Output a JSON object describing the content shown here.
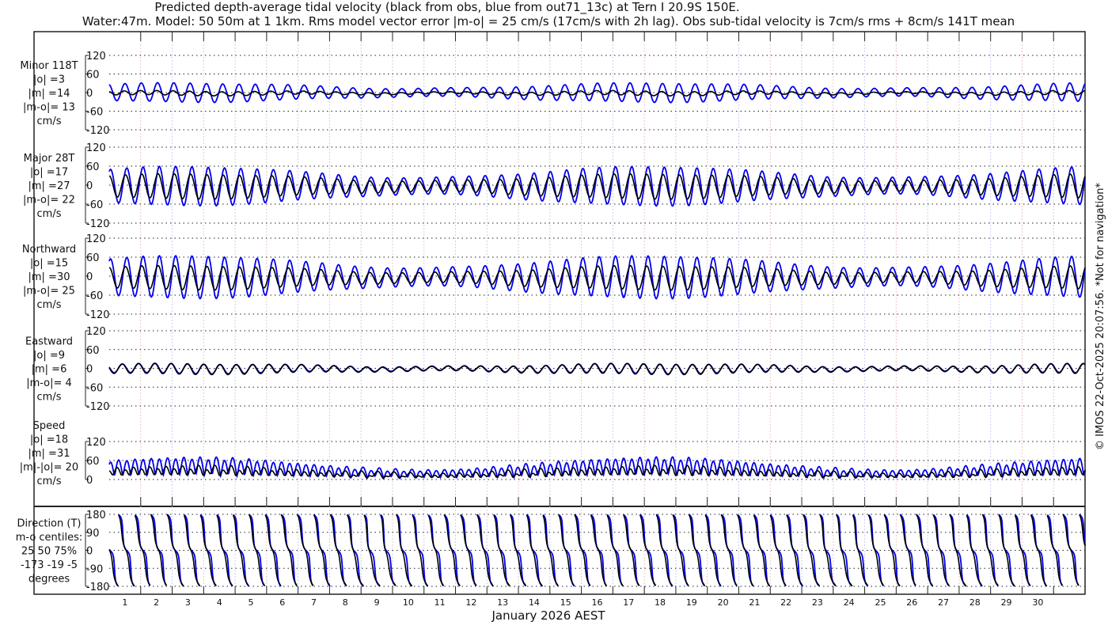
{
  "title": {
    "line1": "Predicted depth-average tidal velocity (black from obs, blue from out71_13c) at Tern I 20.9S 150E.",
    "line2": "Water:47m. Model: 50 50m at 1 1km. Rms model vector error |m-o| = 25 cm/s (17cm/s with 2h lag). Obs sub-tidal velocity is 7cm/s rms + 8cm/s 141T mean"
  },
  "copyright": "© IMOS 22-Oct-2025 20:07:56. *Not for navigation*",
  "colors": {
    "obs": "#000000",
    "model": "#0000ee"
  },
  "chart_data": [
    {
      "type": "line",
      "name": "minor",
      "labels": [
        "Minor 118T",
        "|o| =3",
        "|m| =14",
        "|m-o|= 13",
        "cm/s"
      ],
      "ylim": [
        -120,
        120
      ],
      "yticks": [
        "120",
        "60",
        "0",
        "-60",
        "-120"
      ],
      "tickvals": [
        120,
        60,
        0,
        -60,
        -120
      ],
      "obs_amp": 5,
      "model_amp": 22
    },
    {
      "type": "line",
      "name": "major",
      "labels": [
        "Major 28T",
        "|o| =17",
        "|m| =27",
        "|m-o|= 22",
        "cm/s"
      ],
      "ylim": [
        -120,
        120
      ],
      "yticks": [
        "120",
        "60",
        "0",
        "-60",
        "-120"
      ],
      "tickvals": [
        120,
        60,
        0,
        -60,
        -120
      ],
      "obs_amp": 28,
      "model_amp": 44
    },
    {
      "type": "line",
      "name": "northward",
      "labels": [
        "Northward",
        "|o| =15",
        "|m| =30",
        "|m-o|= 25",
        "cm/s"
      ],
      "ylim": [
        -120,
        120
      ],
      "yticks": [
        "120",
        "60",
        "0",
        "-60",
        "-120"
      ],
      "tickvals": [
        120,
        60,
        0,
        -60,
        -120
      ],
      "obs_amp": 27,
      "model_amp": 48
    },
    {
      "type": "line",
      "name": "eastward",
      "labels": [
        "Eastward",
        "|o| =9",
        "|m| =6",
        "|m-o|= 4",
        "cm/s"
      ],
      "ylim": [
        -120,
        120
      ],
      "yticks": [
        "120",
        "60",
        "0",
        "-60",
        "-120"
      ],
      "tickvals": [
        120,
        60,
        0,
        -60,
        -120
      ],
      "obs_amp": 12,
      "model_amp": 11
    },
    {
      "type": "line",
      "name": "speed",
      "labels": [
        "Speed",
        "|o| =18",
        "|m| =31",
        "|m|-|o|= 20",
        "cm/s"
      ],
      "ylim": [
        0,
        120
      ],
      "yticks": [
        "120",
        "60",
        "0"
      ],
      "tickvals": [
        120,
        60,
        0
      ]
    },
    {
      "type": "line",
      "name": "direction",
      "labels": [
        "Direction (T)",
        "m-o centiles:",
        "25  50  75%",
        "-173  -19   -5",
        "degrees"
      ],
      "ylim": [
        -180,
        180
      ],
      "yticks": [
        "180",
        "90",
        "0",
        "-90",
        "-180"
      ],
      "tickvals": [
        180,
        90,
        0,
        -90,
        -180
      ]
    }
  ],
  "xaxis": {
    "label": "January 2026 AEST",
    "days": [
      "1",
      "2",
      "3",
      "4",
      "5",
      "6",
      "7",
      "8",
      "9",
      "10",
      "11",
      "12",
      "13",
      "14",
      "15",
      "16",
      "17",
      "18",
      "19",
      "20",
      "21",
      "22",
      "23",
      "24",
      "25",
      "26",
      "27",
      "28",
      "29",
      "30"
    ],
    "range_days": 31
  }
}
